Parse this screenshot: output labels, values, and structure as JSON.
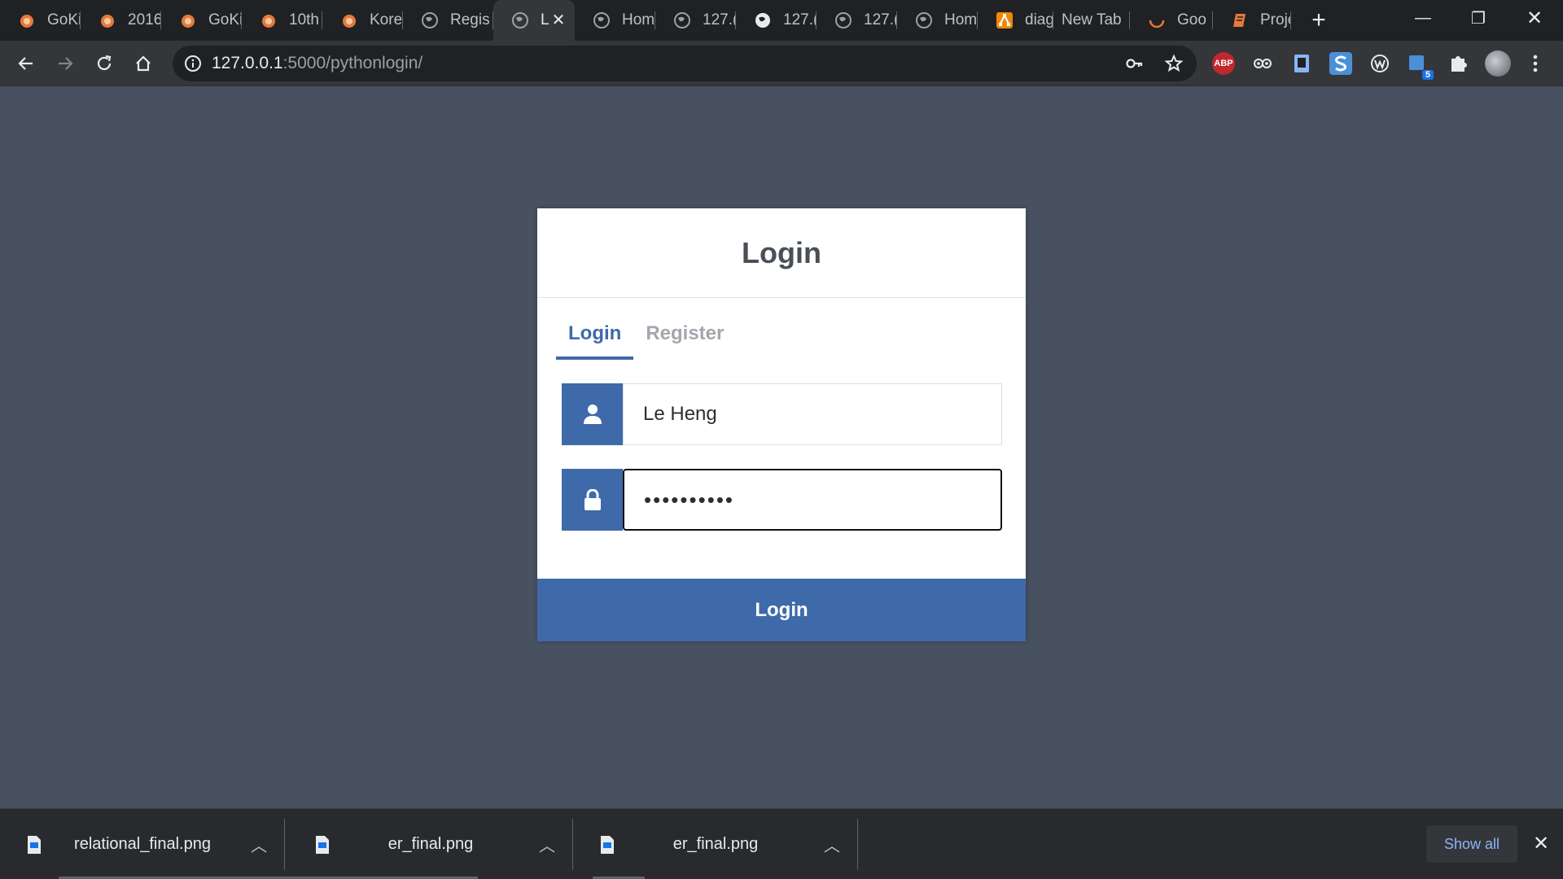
{
  "browser": {
    "tabs": [
      {
        "title": "GoKi",
        "icon": "squirrel-icon"
      },
      {
        "title": "2016",
        "icon": "squirrel-icon"
      },
      {
        "title": "GoKi",
        "icon": "squirrel-icon"
      },
      {
        "title": "10th",
        "icon": "squirrel-icon"
      },
      {
        "title": "Kore",
        "icon": "squirrel-icon"
      },
      {
        "title": "Regis",
        "icon": "globe-icon"
      },
      {
        "title": "L",
        "icon": "globe-icon",
        "active": true
      },
      {
        "title": "Hom",
        "icon": "globe-icon"
      },
      {
        "title": "127.(",
        "icon": "globe-icon"
      },
      {
        "title": "127.(",
        "icon": "globe-icon"
      },
      {
        "title": "127.(",
        "icon": "globe-icon"
      },
      {
        "title": "Hom",
        "icon": "globe-icon"
      },
      {
        "title": "diag",
        "icon": "diagram-icon"
      },
      {
        "title": "New Tab",
        "icon": ""
      },
      {
        "title": "Goo",
        "icon": "google-loading-icon"
      },
      {
        "title": "Proje",
        "icon": "book-icon"
      }
    ],
    "address": {
      "host": "127.0.0.1",
      "path": ":5000/pythonlogin/"
    },
    "extensions": {
      "adblock_label": "ABP",
      "badge_count": "5"
    }
  },
  "page": {
    "title": "Login",
    "tabs": {
      "login": "Login",
      "register": "Register"
    },
    "username": {
      "value": "Le Heng"
    },
    "password": {
      "value": "••••••••••"
    },
    "submit_label": "Login"
  },
  "downloads": {
    "items": [
      {
        "name": "relational_final.png"
      },
      {
        "name": "er_final.png"
      },
      {
        "name": "er_final.png"
      }
    ],
    "show_all_label": "Show all"
  },
  "colors": {
    "background": "#475160",
    "accent": "#3f6aa9"
  }
}
